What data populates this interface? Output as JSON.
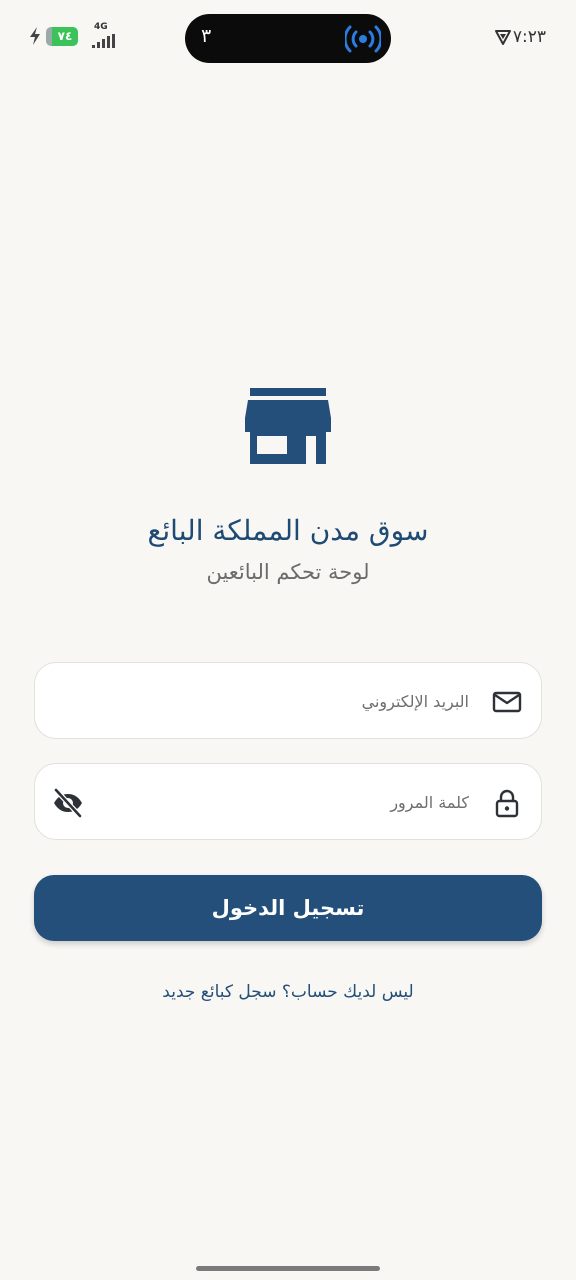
{
  "status_bar": {
    "time": "٧:٢٣",
    "battery": "٧٤",
    "network": "4G",
    "island_count": "٣",
    "icons": [
      "charging-bolt-icon",
      "battery-icon",
      "cell-signal-icon",
      "vpn-shield-icon",
      "broadcast-icon"
    ]
  },
  "app": {
    "logo_icon": "store-icon",
    "title": "سوق مدن المملكة البائع",
    "subtitle": "لوحة تحكم البائعين"
  },
  "form": {
    "email": {
      "value": "",
      "placeholder": "البريد الإلكتروني",
      "icon": "mail-icon"
    },
    "password": {
      "value": "",
      "placeholder": "كلمة المرور",
      "icon": "lock-icon",
      "toggle_icon": "eye-off-icon"
    },
    "login_label": "تسجيل الدخول",
    "register_link": "ليس لديك حساب؟ سجل كبائع جديد"
  },
  "colors": {
    "primary": "#234f7a",
    "background": "#f8f7f4",
    "battery_green": "#3bc35a",
    "broadcast_blue": "#2a7de1"
  }
}
